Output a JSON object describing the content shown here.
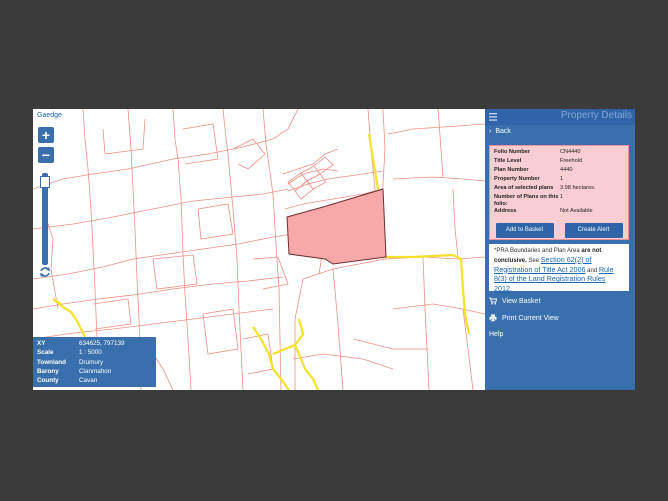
{
  "map": {
    "brand": "Gaedge",
    "zoom_in": "+",
    "zoom_out": "−",
    "info": [
      {
        "key": "XY",
        "value": "634625, 797139"
      },
      {
        "key": "Scale",
        "value": "1 : 5000"
      },
      {
        "key": "Townland",
        "value": "Drumury"
      },
      {
        "key": "Barony",
        "value": "Clanmahon"
      },
      {
        "key": "County",
        "value": "Cavan"
      }
    ],
    "colors": {
      "boundary": "#f08f84",
      "road": "#f5e02a",
      "selected_fill": "#f7a8a8",
      "selected_edge": "#6b3030"
    }
  },
  "panel": {
    "title": "Property Details",
    "back": "Back",
    "details": [
      {
        "key": "Folio Number",
        "value": "CN4440"
      },
      {
        "key": "Title Level",
        "value": "Freehold"
      },
      {
        "key": "Plan Number",
        "value": "4440"
      },
      {
        "key": "Property Number",
        "value": "1"
      },
      {
        "key": "Area of selected plans",
        "value": "3.98 hectares."
      },
      {
        "key": "Number of Plans on this folio:",
        "value": "1"
      },
      {
        "key": "Address",
        "value": "Not Available"
      }
    ],
    "add_to_basket": "Add to Basket",
    "create_alert": "Create Alert",
    "note": {
      "prefix": "*PRA Boundaries and Plan Area",
      "bold": "are not conclusive.",
      "see": "See",
      "link1": "Section 62(2) of Registration of Title Act 2006",
      "and": "and",
      "link2": "Rule 8(3) of the Land Registration Rules 2012",
      "end": "."
    },
    "menu": {
      "view_basket": "View Basket",
      "print_view": "Print Current View",
      "help": "Help"
    },
    "icons": [
      "menu-icon",
      "basket-icon",
      "print-icon"
    ]
  }
}
